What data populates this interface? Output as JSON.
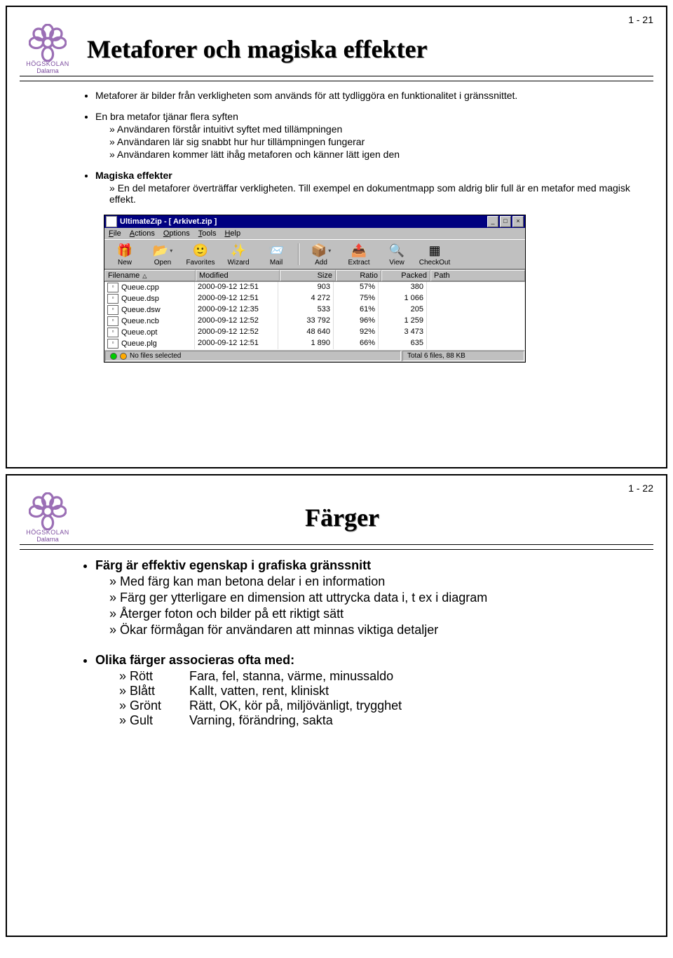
{
  "slide1": {
    "number": "1 - 21",
    "logo_line1": "HÖGSKOLAN",
    "logo_line2": "Dalarna",
    "title": "Metaforer och magiska effekter",
    "p1": "Metaforer är bilder från verkligheten som används för att tydliggöra en funktionalitet i gränssnittet.",
    "p2": "En bra metafor tjänar flera syften",
    "p2s": [
      "Användaren förstår intuitivt syftet med tillämpningen",
      "Användaren lär sig snabbt hur hur tillämpningen fungerar",
      "Användaren kommer lätt ihåg metaforen och känner lätt igen den"
    ],
    "p3": "Magiska effekter",
    "p3s": [
      "En del metaforer överträffar verkligheten. Till exempel en dokumentmapp som aldrig blir full är en metafor med magisk effekt."
    ],
    "app": {
      "title": "UltimateZip - [ Arkivet.zip ]",
      "menus": [
        "File",
        "Actions",
        "Options",
        "Tools",
        "Help"
      ],
      "tools": [
        {
          "label": "New",
          "icon": "🎁"
        },
        {
          "label": "Open",
          "icon": "📂",
          "drop": true
        },
        {
          "label": "Favorites",
          "icon": "🙂"
        },
        {
          "label": "Wizard",
          "icon": "✨"
        },
        {
          "label": "Mail",
          "icon": "📨"
        },
        {
          "label": "Add",
          "icon": "📦",
          "drop": true
        },
        {
          "label": "Extract",
          "icon": "📤"
        },
        {
          "label": "View",
          "icon": "🔍"
        },
        {
          "label": "CheckOut",
          "icon": "▦"
        }
      ],
      "columns": [
        "Filename",
        "Modified",
        "Size",
        "Ratio",
        "Packed",
        "Path"
      ],
      "rows": [
        {
          "fn": "Queue.cpp",
          "mod": "2000-09-12 12:51",
          "size": "903",
          "ratio": "57%",
          "packed": "380"
        },
        {
          "fn": "Queue.dsp",
          "mod": "2000-09-12 12:51",
          "size": "4 272",
          "ratio": "75%",
          "packed": "1 066"
        },
        {
          "fn": "Queue.dsw",
          "mod": "2000-09-12 12:35",
          "size": "533",
          "ratio": "61%",
          "packed": "205"
        },
        {
          "fn": "Queue.ncb",
          "mod": "2000-09-12 12:52",
          "size": "33 792",
          "ratio": "96%",
          "packed": "1 259"
        },
        {
          "fn": "Queue.opt",
          "mod": "2000-09-12 12:52",
          "size": "48 640",
          "ratio": "92%",
          "packed": "3 473"
        },
        {
          "fn": "Queue.plg",
          "mod": "2000-09-12 12:51",
          "size": "1 890",
          "ratio": "66%",
          "packed": "635"
        }
      ],
      "status_left": "No files selected",
      "status_right": "Total 6 files, 88 KB",
      "btn_min": "_",
      "btn_max": "□",
      "btn_close": "×"
    }
  },
  "slide2": {
    "number": "1 - 22",
    "logo_line1": "HÖGSKOLAN",
    "logo_line2": "Dalarna",
    "title": "Färger",
    "p1": "Färg är effektiv egenskap i grafiska gränssnitt",
    "p1s": [
      "Med färg kan man betona delar i en information",
      "Färg ger ytterligare en dimension att uttrycka data i, t ex i diagram",
      "Återger foton och bilder på ett riktigt sätt",
      "Ökar förmågan för användaren att minnas viktiga detaljer"
    ],
    "p2": "Olika färger associeras ofta med:",
    "colors": [
      {
        "name": "Rött",
        "desc": "Fara, fel, stanna, värme, minussaldo"
      },
      {
        "name": "Blått",
        "desc": "Kallt, vatten, rent, kliniskt"
      },
      {
        "name": "Grönt",
        "desc": "Rätt, OK, kör på, miljövänligt, trygghet"
      },
      {
        "name": "Gult",
        "desc": "Varning, förändring, sakta"
      }
    ]
  }
}
